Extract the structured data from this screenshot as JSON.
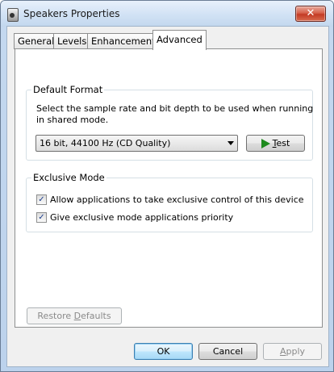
{
  "window": {
    "title": "Speakers Properties",
    "close_glyph": "✕"
  },
  "tabs": [
    {
      "label": "General"
    },
    {
      "label": "Levels"
    },
    {
      "label": "Enhancements"
    },
    {
      "label": "Advanced",
      "active": true
    }
  ],
  "default_format": {
    "title": "Default Format",
    "description": "Select the sample rate and bit depth to be used when running in shared mode.",
    "selected_format": "16 bit, 44100 Hz (CD Quality)",
    "test_button": {
      "prefix": "",
      "accel": "T",
      "rest": "est"
    }
  },
  "exclusive_mode": {
    "title": "Exclusive Mode",
    "options": [
      {
        "label": "Allow applications to take exclusive control of this device",
        "checked": true
      },
      {
        "label": "Give exclusive mode applications priority",
        "checked": true
      }
    ]
  },
  "restore_defaults": {
    "prefix": "Restore ",
    "accel": "D",
    "rest": "efaults"
  },
  "footer": {
    "ok_label": "OK",
    "cancel_label": "Cancel",
    "apply": {
      "prefix": "",
      "accel": "A",
      "rest": "pply"
    }
  },
  "icons": {
    "check": "✓",
    "play": "play-icon",
    "speaker": "speaker-icon"
  }
}
